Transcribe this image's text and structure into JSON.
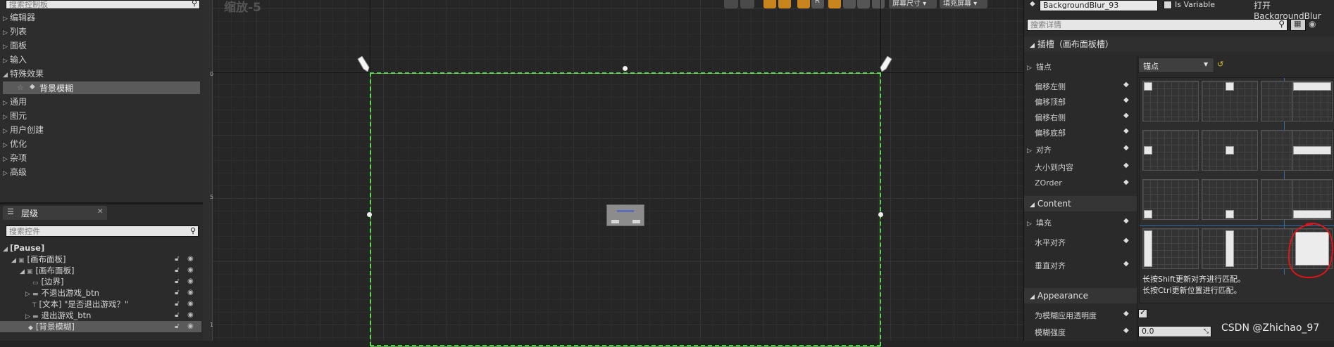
{
  "palette": {
    "search_placeholder": "搜索控制板",
    "categories": [
      "编辑器",
      "列表",
      "面板",
      "输入",
      "特殊效果",
      "通用",
      "图元",
      "用户创建",
      "优化",
      "杂项",
      "高级"
    ],
    "selected_item": "背景模糊"
  },
  "hierarchy": {
    "tab_label": "层级",
    "search_placeholder": "搜索控件",
    "root": "[Pause]",
    "rows": [
      {
        "label": "[画布面板]"
      },
      {
        "label": "[画布面板]"
      },
      {
        "label": "[边界]"
      },
      {
        "label": "不退出游戏_btn"
      },
      {
        "label": "[文本] \"是否退出游戏？\""
      },
      {
        "label": "退出游戏_btn"
      },
      {
        "label": "[背景模糊]"
      }
    ]
  },
  "canvas": {
    "zoom_label": "缩放-5",
    "toolbar_screen_size": "屏幕尺寸 ▾",
    "toolbar_fill_screen": "填充屏幕 ▾",
    "toolbar_r": "R",
    "ruler_zero": "0",
    "ruler_five": "5",
    "ruler_ten": "1"
  },
  "details": {
    "widget_name": "BackgroundBlur_93",
    "is_variable_label": "Is Variable",
    "open_link": "打开BackgroundBlur",
    "search_placeholder": "搜索详情",
    "slot_section": "插槽（画布面板槽）",
    "anchor_label": "锚点",
    "anchor_value": "锚点",
    "props": [
      "偏移左侧",
      "偏移顶部",
      "偏移右侧",
      "偏移底部",
      "对齐",
      "大小到内容",
      "ZOrder"
    ],
    "content_section": "Content",
    "content_props": [
      "填充",
      "水平对齐",
      "垂直对齐"
    ],
    "anchor_hint_1": "长按Shift更新对齐进行匹配。",
    "anchor_hint_2": "长按Ctrl更新位置进行匹配。",
    "appearance_section": "Appearance",
    "apply_alpha_label": "为模糊应用透明度",
    "blur_strength_label": "模糊强度",
    "blur_strength_value": "0.0"
  },
  "watermark": "CSDN @Zhichao_97",
  "colors": {
    "selection_green": "#3fd23f",
    "highlight_circle": "#e01515",
    "anchor_line": "#2f6ea8"
  }
}
